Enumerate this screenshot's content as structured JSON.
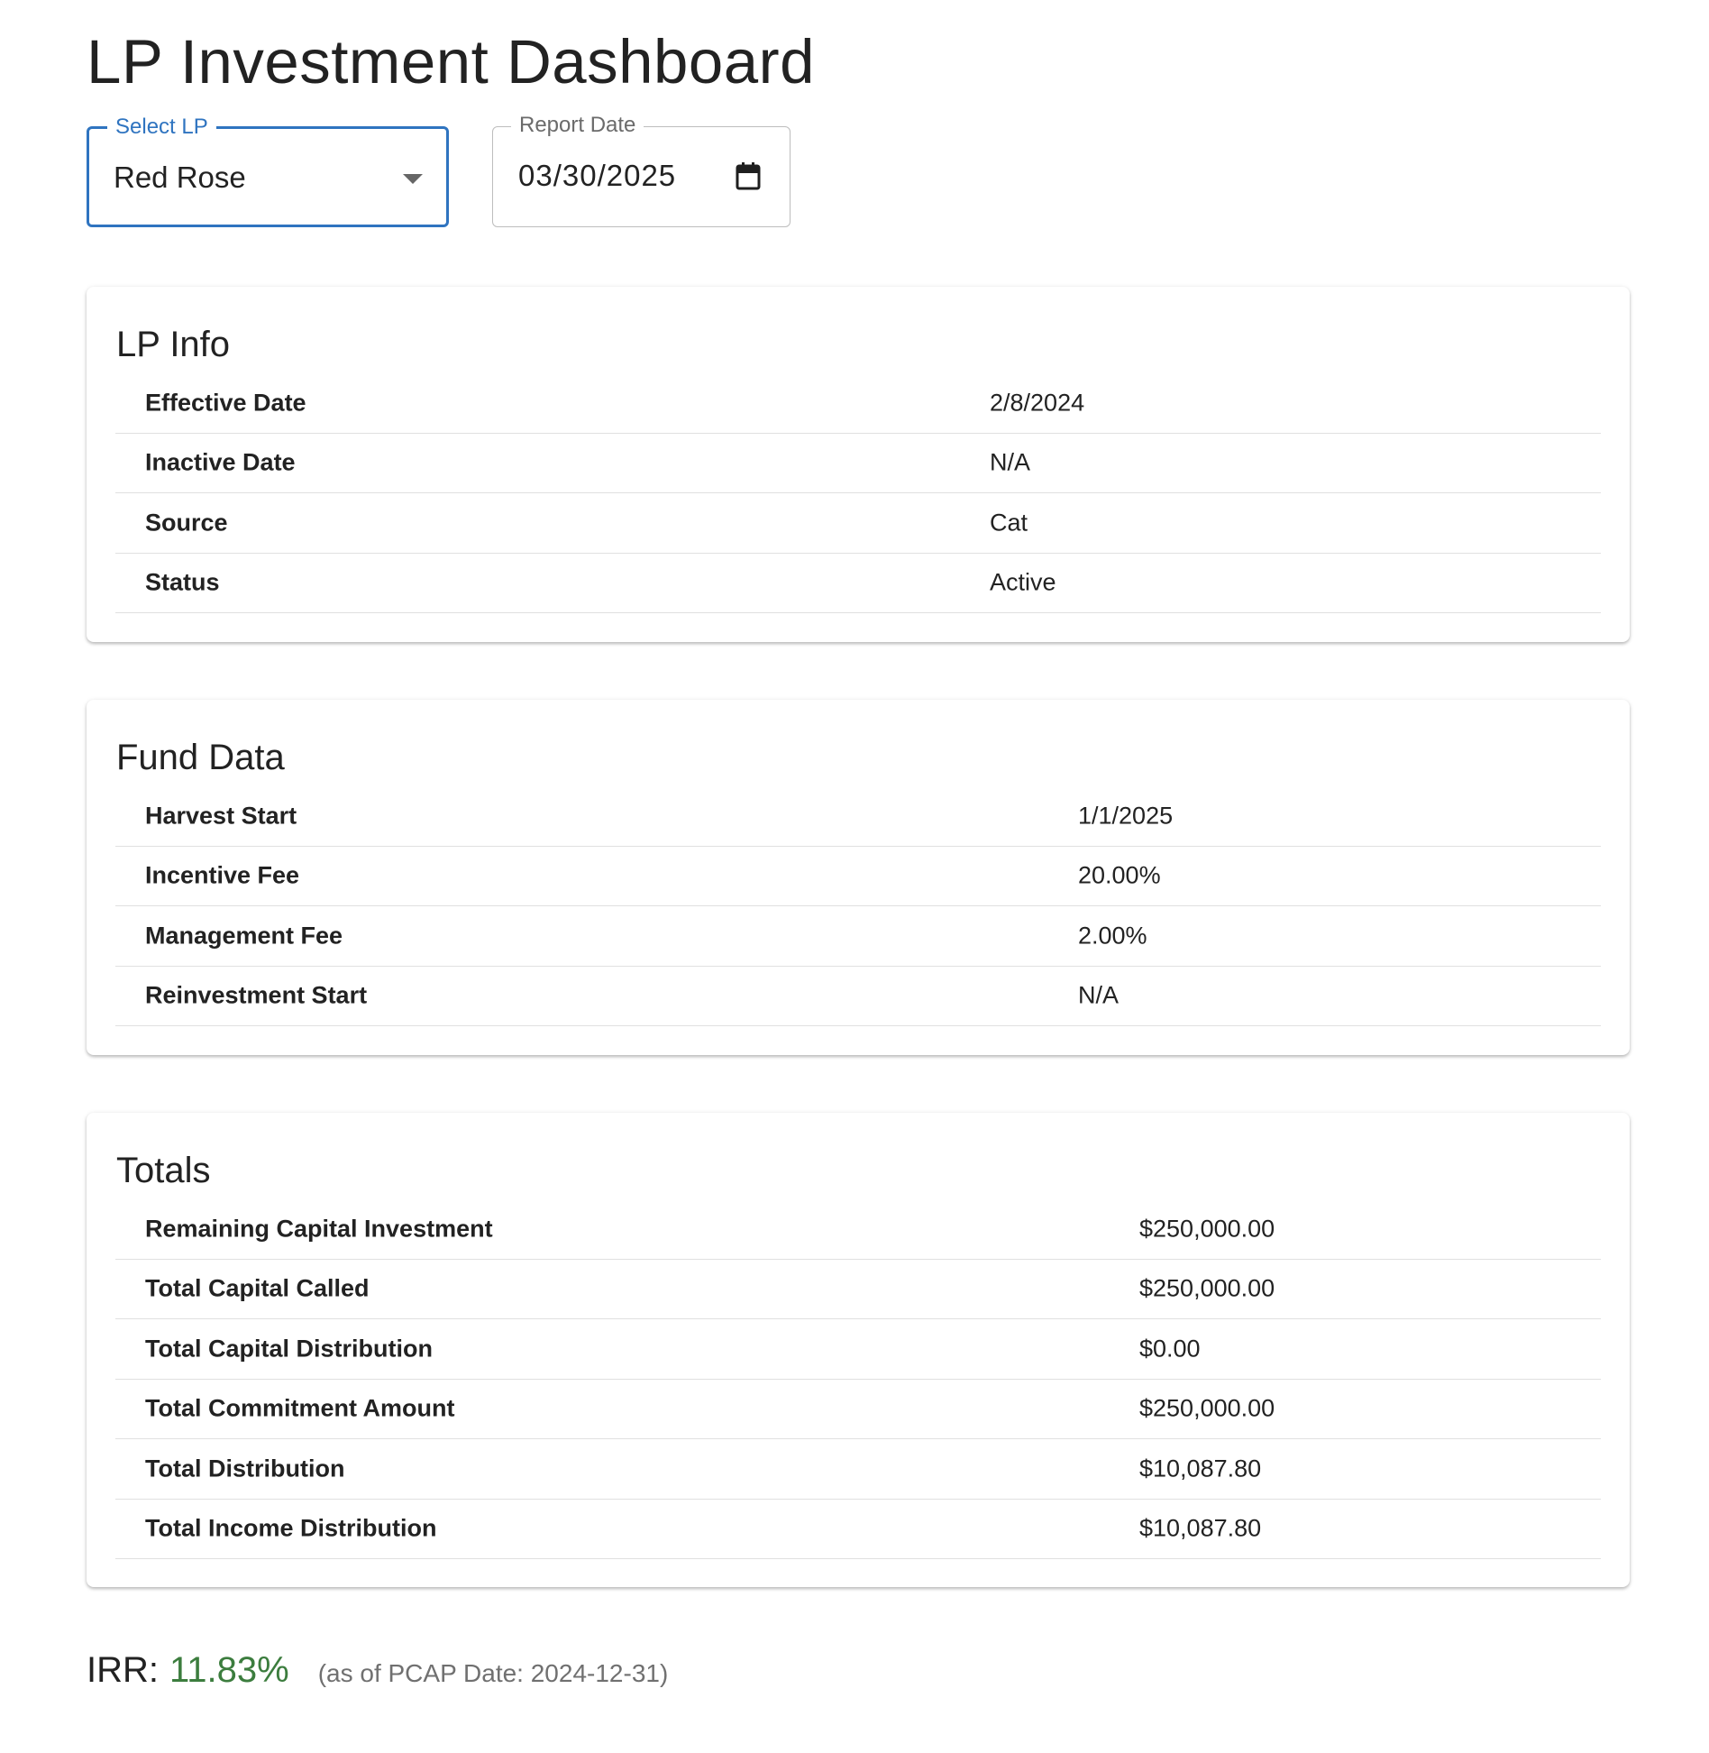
{
  "header": {
    "title": "LP Investment Dashboard"
  },
  "filters": {
    "lp_select": {
      "label": "Select LP",
      "value": "Red Rose"
    },
    "report_date": {
      "label": "Report Date",
      "value": "03/30/2025"
    }
  },
  "lp_info": {
    "title": "LP Info",
    "rows": [
      {
        "label": "Effective Date",
        "value": "2/8/2024"
      },
      {
        "label": "Inactive Date",
        "value": "N/A"
      },
      {
        "label": "Source",
        "value": "Cat"
      },
      {
        "label": "Status",
        "value": "Active"
      }
    ]
  },
  "fund_data": {
    "title": "Fund Data",
    "rows": [
      {
        "label": "Harvest Start",
        "value": "1/1/2025"
      },
      {
        "label": "Incentive Fee",
        "value": "20.00%"
      },
      {
        "label": "Management Fee",
        "value": "2.00%"
      },
      {
        "label": "Reinvestment Start",
        "value": "N/A"
      }
    ]
  },
  "totals": {
    "title": "Totals",
    "rows": [
      {
        "label": "Remaining Capital Investment",
        "value": "$250,000.00"
      },
      {
        "label": "Total Capital Called",
        "value": "$250,000.00"
      },
      {
        "label": "Total Capital Distribution",
        "value": "$0.00"
      },
      {
        "label": "Total Commitment Amount",
        "value": "$250,000.00"
      },
      {
        "label": "Total Distribution",
        "value": "$10,087.80"
      },
      {
        "label": "Total Income Distribution",
        "value": "$10,087.80"
      }
    ]
  },
  "irr": {
    "label": "IRR:",
    "value": "11.83%",
    "note": "(as of PCAP Date: 2024-12-31)",
    "value_color": "#3c7d3e"
  },
  "colors": {
    "accent": "#2f74c0",
    "text": "#222222",
    "muted": "#707070",
    "divider": "#e0e0e0"
  },
  "icons": {
    "dropdown": "chevron-down-icon",
    "date": "calendar-icon"
  }
}
